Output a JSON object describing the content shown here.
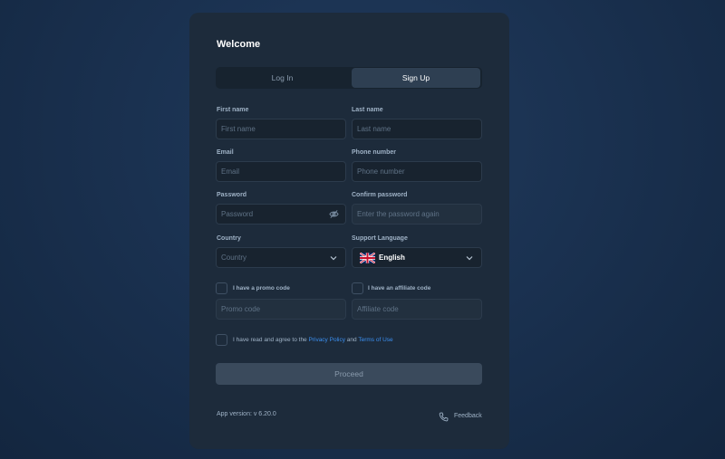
{
  "card": {
    "title": "Welcome",
    "tabs": {
      "login": "Log In",
      "signup": "Sign Up"
    }
  },
  "form": {
    "first_name": {
      "label": "First name",
      "placeholder": "First name"
    },
    "last_name": {
      "label": "Last name",
      "placeholder": "Last name"
    },
    "email": {
      "label": "Email",
      "placeholder": "Email"
    },
    "phone": {
      "label": "Phone number",
      "placeholder": "Phone number"
    },
    "password": {
      "label": "Password",
      "placeholder": "Password"
    },
    "confirm_password": {
      "label": "Confirm password",
      "placeholder": "Enter the password again"
    },
    "country": {
      "label": "Country",
      "placeholder": "Country"
    },
    "language": {
      "label": "Support Language",
      "value": "English"
    },
    "promo": {
      "checkbox_label": "I have a promo code",
      "placeholder": "Promo code"
    },
    "affiliate": {
      "checkbox_label": "I have an affiliate code",
      "placeholder": "Affiliate code"
    },
    "agree": {
      "prefix": "I have read and agree to the",
      "privacy_link": "Privacy Policy",
      "conjunction": "and",
      "terms_link": "Terms of Use"
    },
    "proceed_label": "Proceed"
  },
  "footer": {
    "version": "App version: v 6.20.0",
    "feedback": "Feedback"
  },
  "colors": {
    "background": "#1a3150",
    "card": "#1d2b3b",
    "link": "#3b8ff0",
    "active_tab": "#2e3f52"
  },
  "icons": [
    "eye-off-icon",
    "chevron-down-icon",
    "uk-flag-icon",
    "phone-icon"
  ]
}
